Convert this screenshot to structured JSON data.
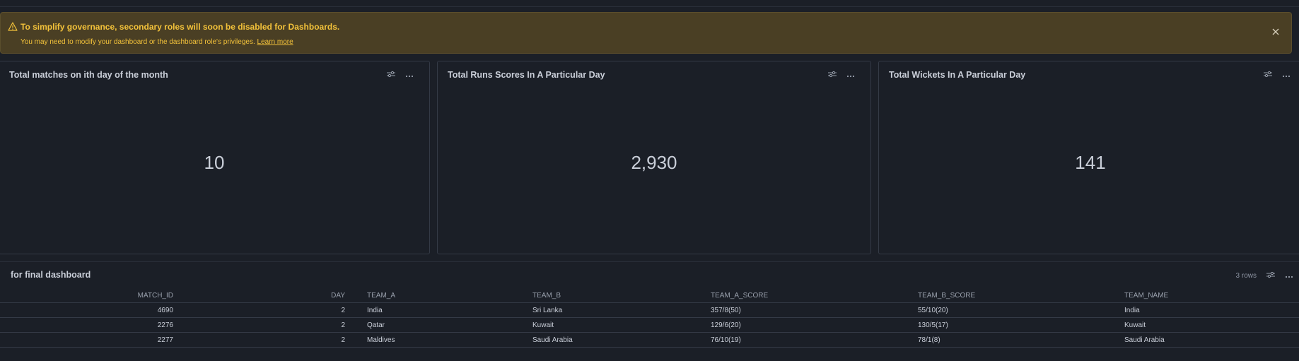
{
  "banner": {
    "title": "To simplify governance, secondary roles will soon be disabled for Dashboards.",
    "body": "You may need to modify your dashboard or the dashboard role's privileges.",
    "link": "Learn more",
    "icon": "warning-triangle-icon",
    "close_icon": "close-icon"
  },
  "tiles": [
    {
      "title": "Total matches on ith day of the month",
      "value": "10"
    },
    {
      "title": "Total Runs Scores In A Particular Day",
      "value": "2,930"
    },
    {
      "title": "Total Wickets In A Particular Day",
      "value": "141"
    }
  ],
  "table": {
    "title": "for final dashboard",
    "row_count": "3 rows",
    "columns": [
      "MATCH_ID",
      "DAY",
      "TEAM_A",
      "TEAM_B",
      "TEAM_A_SCORE",
      "TEAM_B_SCORE",
      "TEAM_NAME"
    ],
    "rows": [
      [
        "4690",
        "2",
        "India",
        "Sri Lanka",
        "357/8(50)",
        "55/10(20)",
        "India"
      ],
      [
        "2276",
        "2",
        "Qatar",
        "Kuwait",
        "129/6(20)",
        "130/5(17)",
        "Kuwait"
      ],
      [
        "2277",
        "2",
        "Maldives",
        "Saudi Arabia",
        "76/10(19)",
        "78/1(8)",
        "Saudi Arabia"
      ]
    ]
  },
  "colors": {
    "background": "#1b1f27",
    "banner_bg": "#4a3f24",
    "banner_text": "#f3c23a",
    "border": "#343a46"
  }
}
